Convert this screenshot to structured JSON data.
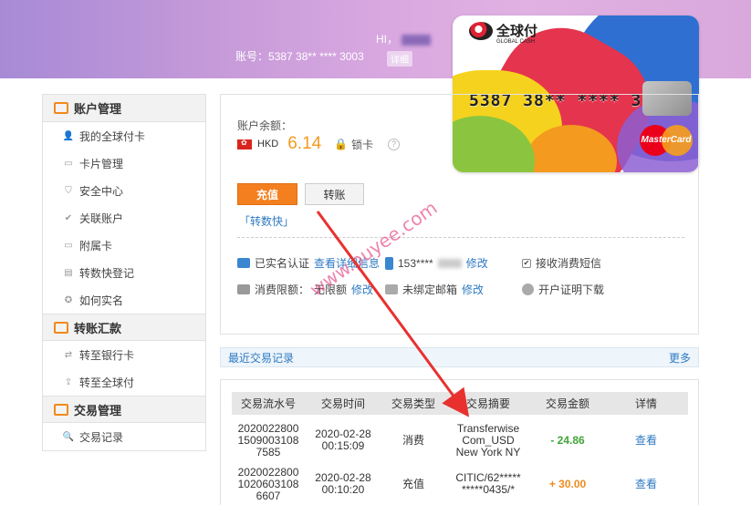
{
  "header": {
    "greeting": "HI，",
    "account_label": "账号：",
    "account_number": "5387 38** **** 3003",
    "detail_link": "详细"
  },
  "card": {
    "brand": "全球付",
    "brand_sub": "GLOBAL CASH",
    "number": "5387 38** **** 3003",
    "network": "MasterCard"
  },
  "sidebar": {
    "sections": [
      {
        "title": "账户管理",
        "items": [
          "我的全球付卡",
          "卡片管理",
          "安全中心",
          "关联账户",
          "附属卡",
          "转数快登记",
          "如何实名"
        ]
      },
      {
        "title": "转账汇款",
        "items": [
          "转至银行卡",
          "转至全球付"
        ]
      },
      {
        "title": "交易管理",
        "items": [
          "交易记录"
        ]
      }
    ]
  },
  "account": {
    "balance_label": "账户余额：",
    "currency": "HKD",
    "balance": "6.14",
    "lock_label": "锁卡",
    "help": "?",
    "recharge_button": "充值",
    "transfer_button": "转账",
    "fps_link": "「转数快」",
    "verified_text": "已实名认证",
    "view_detail_link": "查看详细信息",
    "phone": "153****",
    "modify": "修改",
    "sms_label": "接收消费短信",
    "limit_label": "消费限额：",
    "limit_value": "无限额",
    "email_label": "未绑定邮箱",
    "certificate_link": "开户证明下载"
  },
  "recent": {
    "title": "最近交易记录",
    "more": "更多",
    "columns": [
      "交易流水号",
      "交易时间",
      "交易类型",
      "交易摘要",
      "交易金额",
      "详情"
    ],
    "rows": [
      {
        "serial": [
          "2020022800",
          "1509003108",
          "7585"
        ],
        "time": [
          "2020-02-28",
          "00:15:09"
        ],
        "type": "消费",
        "summary": [
          "Transferwise",
          "Com_USD",
          "New York NY"
        ],
        "amount": "- 24.86",
        "detail": "查看"
      },
      {
        "serial": [
          "2020022800",
          "1020603108",
          "6607"
        ],
        "time": [
          "2020-02-28",
          "00:10:20"
        ],
        "type": "充值",
        "summary": [
          "CITIC/62*****",
          "*****0435/*"
        ],
        "amount": "+ 30.00",
        "detail": "查看"
      }
    ]
  },
  "watermark": "www.puyee.com",
  "colors": {
    "accent": "#f47f1f",
    "link": "#2f7ac2",
    "negative": "#41a53a",
    "positive": "#f08a1c",
    "annotation_arrow": "#e8312f"
  }
}
